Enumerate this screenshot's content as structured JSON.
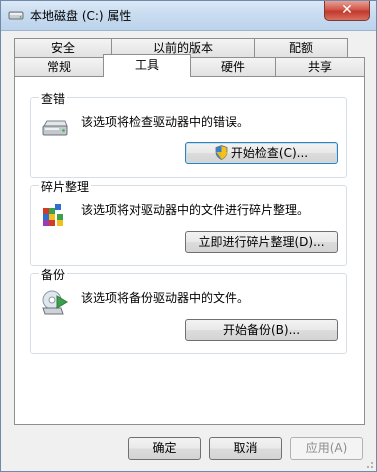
{
  "window": {
    "title": "本地磁盘 (C:) 属性"
  },
  "tabs": {
    "back_row": [
      "安全",
      "以前的版本",
      "配额"
    ],
    "front_row": [
      "常规",
      "工具",
      "硬件",
      "共享"
    ],
    "active": "工具"
  },
  "error_check": {
    "title": "查错",
    "description": "该选项将检查驱动器中的错误。",
    "button": "开始检查(C)..."
  },
  "defrag": {
    "title": "碎片整理",
    "description": "该选项将对驱动器中的文件进行碎片整理。",
    "button": "立即进行碎片整理(D)..."
  },
  "backup": {
    "title": "备份",
    "description": "该选项将备份驱动器中的文件。",
    "button": "开始备份(B)..."
  },
  "footer": {
    "ok": "确定",
    "cancel": "取消",
    "apply": "应用(A)"
  },
  "icons": {
    "title": "drive-icon",
    "close": "close-icon",
    "error_check": "hard-drive-icon",
    "defrag": "defrag-icon",
    "backup": "backup-icon",
    "uac": "uac-shield-icon"
  },
  "colors": {
    "close_button": "#c03a2d",
    "titlebar": "#c9dcf0",
    "dialog_bg": "#f0f0f0",
    "focus_border": "#3c7fb1"
  }
}
